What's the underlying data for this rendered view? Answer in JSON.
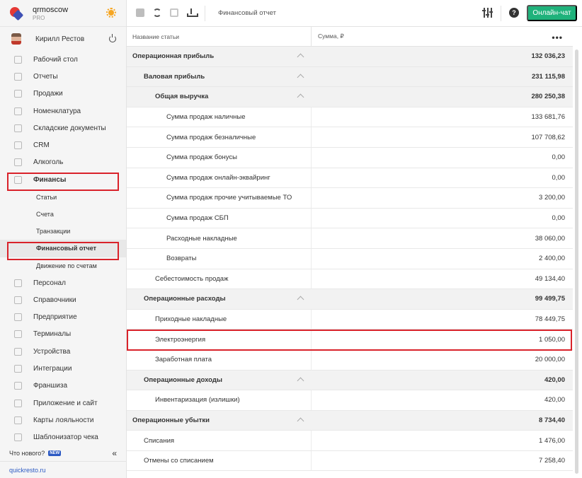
{
  "account": {
    "name": "qrmoscow",
    "plan": "PRO"
  },
  "user": {
    "name": "Кирилл Рестов"
  },
  "nav": {
    "items": [
      {
        "label": "Рабочий стол",
        "icon": "desktop-icon"
      },
      {
        "label": "Отчеты",
        "icon": "chart-icon"
      },
      {
        "label": "Продажи",
        "icon": "basket-icon"
      },
      {
        "label": "Номенклатура",
        "icon": "tag-icon"
      },
      {
        "label": "Складские документы",
        "icon": "box-icon"
      },
      {
        "label": "CRM",
        "icon": "users-icon"
      },
      {
        "label": "Алкоголь",
        "icon": "glass-icon"
      },
      {
        "label": "Финансы",
        "icon": "wallet-icon"
      }
    ],
    "finance_sub": [
      "Статьи",
      "Счета",
      "Транзакции",
      "Финансовый отчет",
      "Движение по счетам"
    ],
    "items_after": [
      {
        "label": "Персонал",
        "icon": "staff-icon"
      },
      {
        "label": "Справочники",
        "icon": "book-icon"
      },
      {
        "label": "Предприятие",
        "icon": "building-icon"
      },
      {
        "label": "Терминалы",
        "icon": "terminal-icon"
      },
      {
        "label": "Устройства",
        "icon": "printer-icon"
      },
      {
        "label": "Интеграции",
        "icon": "link-icon"
      },
      {
        "label": "Франшиза",
        "icon": "network-icon"
      },
      {
        "label": "Приложение и сайт",
        "icon": "monitor-icon"
      },
      {
        "label": "Карты лояльности",
        "icon": "card-icon"
      },
      {
        "label": "Шаблонизатор чека",
        "icon": "receipt-icon"
      }
    ],
    "whats_new": "Что нового?",
    "new_badge": "NEW",
    "collapse": "«",
    "site": "quickresto.ru"
  },
  "toolbar": {
    "title": "Финансовый отчет",
    "chat_label": "Онлайн-чат",
    "help": "?"
  },
  "table": {
    "col_name": "Название статьи",
    "col_sum": "Сумма, ₽",
    "more": "•••",
    "rows": [
      {
        "name": "Операционная прибыль",
        "sum": "132 036,23",
        "level": 0,
        "group": true
      },
      {
        "name": "Валовая прибыль",
        "sum": "231 115,98",
        "level": 1,
        "group": true
      },
      {
        "name": "Общая выручка",
        "sum": "280 250,38",
        "level": 2,
        "group": true
      },
      {
        "name": "Сумма продаж наличные",
        "sum": "133 681,76",
        "level": 3,
        "group": false
      },
      {
        "name": "Сумма продаж безналичные",
        "sum": "107 708,62",
        "level": 3,
        "group": false
      },
      {
        "name": "Сумма продаж бонусы",
        "sum": "0,00",
        "level": 3,
        "group": false
      },
      {
        "name": "Сумма продаж онлайн-эквайринг",
        "sum": "0,00",
        "level": 3,
        "group": false
      },
      {
        "name": "Сумма продаж прочие учитываемые ТО",
        "sum": "3 200,00",
        "level": 3,
        "group": false
      },
      {
        "name": "Сумма продаж СБП",
        "sum": "0,00",
        "level": 3,
        "group": false
      },
      {
        "name": "Расходные накладные",
        "sum": "38 060,00",
        "level": 3,
        "group": false
      },
      {
        "name": "Возвраты",
        "sum": "2 400,00",
        "level": 3,
        "group": false
      },
      {
        "name": "Себестоимость продаж",
        "sum": "49 134,40",
        "level": 2,
        "group": false
      },
      {
        "name": "Операционные расходы",
        "sum": "99 499,75",
        "level": 1,
        "group": true
      },
      {
        "name": "Приходные накладные",
        "sum": "78 449,75",
        "level": 2,
        "group": false
      },
      {
        "name": "Электроэнергия",
        "sum": "1 050,00",
        "level": 2,
        "group": false
      },
      {
        "name": "Заработная плата",
        "sum": "20 000,00",
        "level": 2,
        "group": false
      },
      {
        "name": "Операционные доходы",
        "sum": "420,00",
        "level": 1,
        "group": true
      },
      {
        "name": "Инвентаризация (излишки)",
        "sum": "420,00",
        "level": 2,
        "group": false
      },
      {
        "name": "Операционные убытки",
        "sum": "8 734,40",
        "level": 0,
        "group": true
      },
      {
        "name": "Списания",
        "sum": "1 476,00",
        "level": 1,
        "group": false
      },
      {
        "name": "Отмены со списанием",
        "sum": "7 258,40",
        "level": 1,
        "group": false
      }
    ]
  },
  "colors": {
    "accent_green": "#1fb27b",
    "highlight_red": "#d9222a",
    "link_blue": "#2b59c3"
  }
}
